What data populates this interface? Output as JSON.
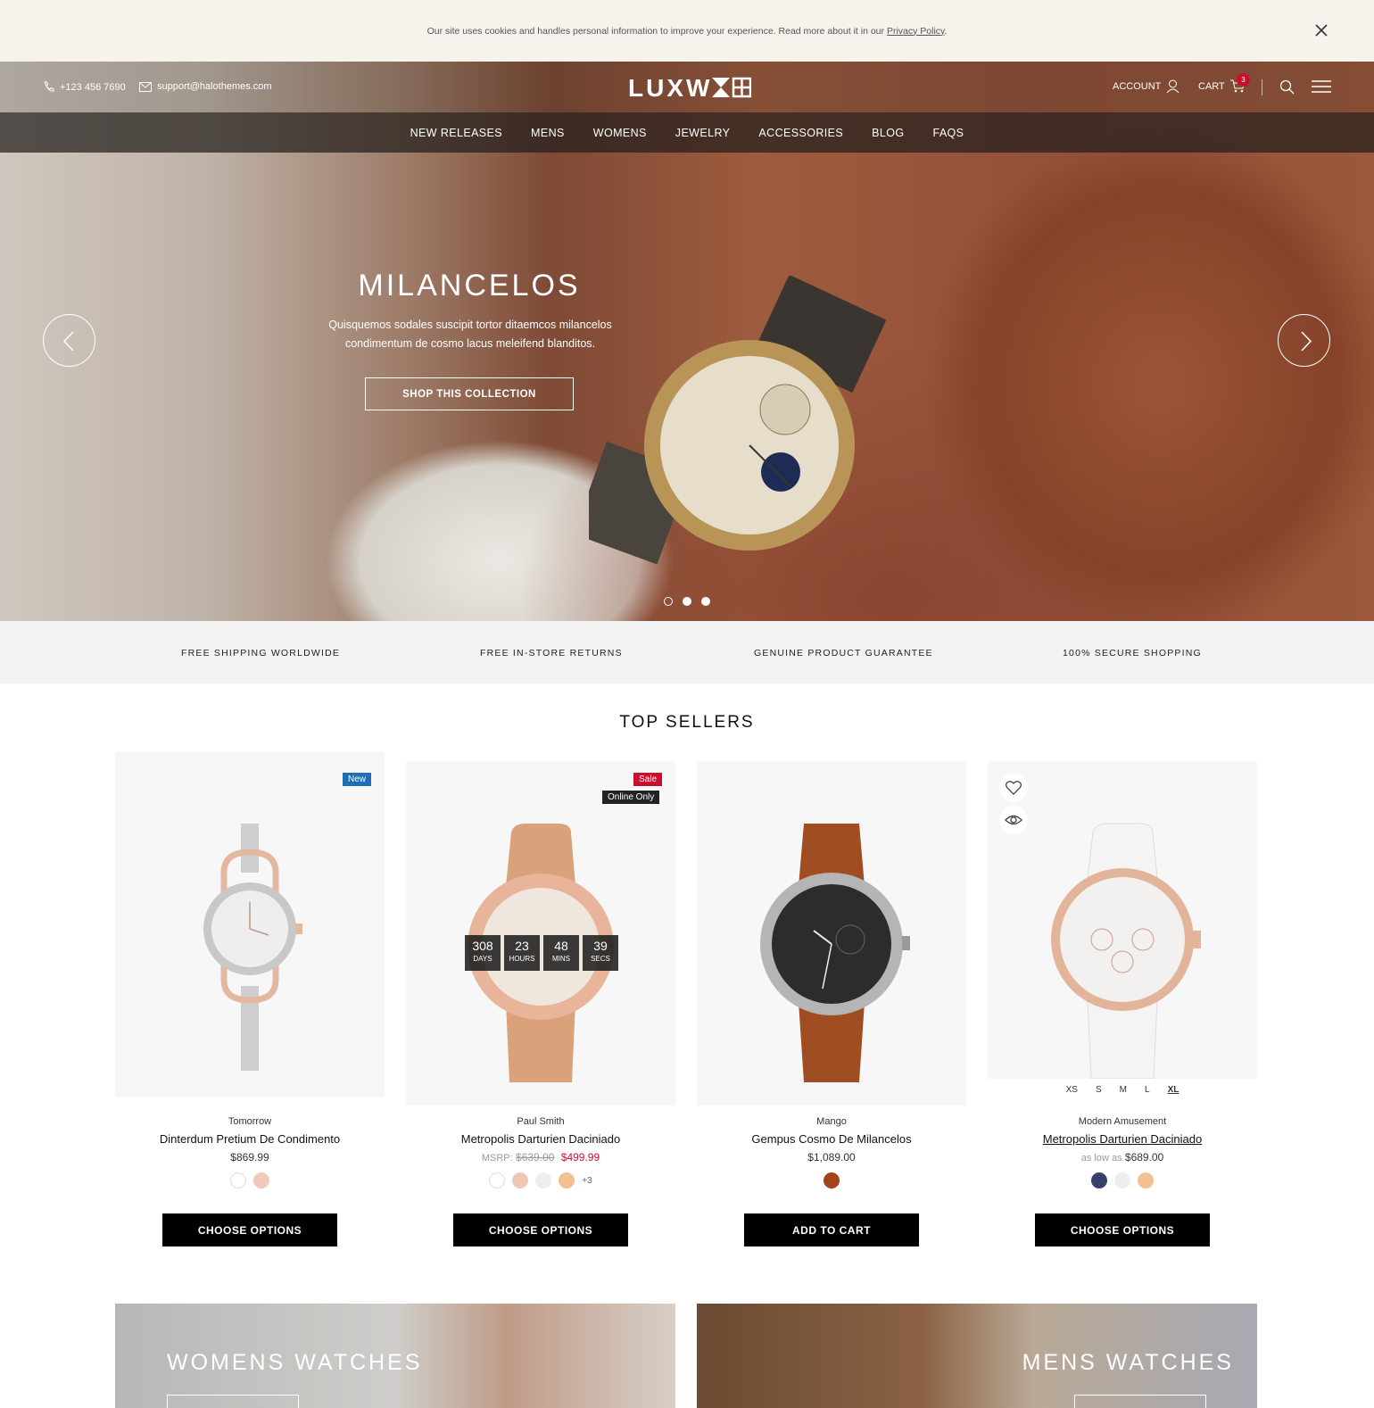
{
  "cookie": {
    "text": "Our site uses cookies and handles personal information to improve your experience. Read more about it in our",
    "link": "Privacy Policy",
    "suffix": "."
  },
  "header": {
    "phone": "+123 456 7690",
    "email": "support@halothemes.com",
    "logo": "LUXW",
    "account": "ACCOUNT",
    "cart": "CART",
    "cart_count": "3"
  },
  "nav": [
    "NEW RELEASES",
    "MENS",
    "WOMENS",
    "JEWELRY",
    "ACCESSORIES",
    "BLOG",
    "FAQS"
  ],
  "hero": {
    "title": "MILANCELOS",
    "subtitle": "Quisquemos sodales suscipit tortor ditaemcos milancelos condimentum de cosmo lacus meleifend blanditos.",
    "cta": "SHOP THIS COLLECTION",
    "slides": 3,
    "active_slide": 2
  },
  "features": [
    "FREE SHIPPING WORLDWIDE",
    "FREE IN-STORE RETURNS",
    "GENUINE PRODUCT GUARANTEE",
    "100% SECURE SHOPPING"
  ],
  "section_title": "TOP SELLERS",
  "products": [
    {
      "badge": "New",
      "vendor": "Tomorrow",
      "title": "Dinterdum Pretium De Condimento",
      "price": "$869.99",
      "swatches": [
        "#ffffff",
        "#f1c9b8"
      ],
      "button": "CHOOSE OPTIONS"
    },
    {
      "badge": "Sale",
      "badge2": "Online Only",
      "vendor": "Paul Smith",
      "title": "Metropolis Darturien Daciniado",
      "msrp_label": "MSRP:",
      "msrp": "$639.00",
      "price": "$499.99",
      "countdown": [
        {
          "value": "308",
          "label": "DAYS"
        },
        {
          "value": "23",
          "label": "HOURS"
        },
        {
          "value": "48",
          "label": "MINS"
        },
        {
          "value": "39",
          "label": "SECS"
        }
      ],
      "swatches": [
        "#ffffff",
        "#f0c7b3",
        "#eeeeee",
        "#f3c08e"
      ],
      "more": "+3",
      "button": "CHOOSE OPTIONS"
    },
    {
      "vendor": "Mango",
      "title": "Gempus Cosmo De Milancelos",
      "price": "$1,089.00",
      "swatches": [
        "#a3431c"
      ],
      "button": "ADD TO CART"
    },
    {
      "vendor": "Modern Amusement",
      "title": "Metropolis Darturien Daciniado",
      "price_prefix": "as low as",
      "price": "$689.00",
      "sizes": [
        "XS",
        "S",
        "M",
        "L",
        "XL"
      ],
      "swatches": [
        "#36426b",
        "#eeeeee",
        "#f3c08e"
      ],
      "button": "CHOOSE OPTIONS"
    }
  ],
  "banners": [
    "WOMENS WATCHES",
    "MENS WATCHES"
  ],
  "colors": {
    "accent": "#000000",
    "sale": "#c8102e",
    "new": "#1f6fb5"
  }
}
